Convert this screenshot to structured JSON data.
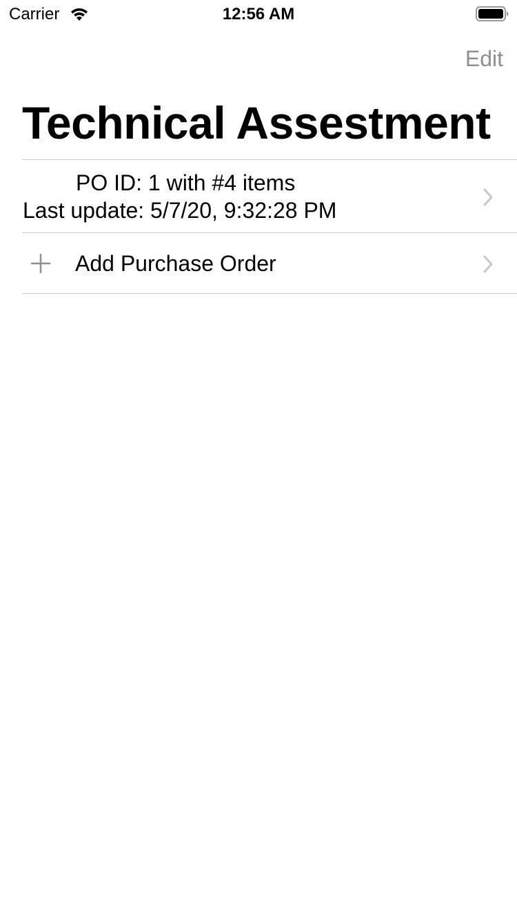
{
  "status_bar": {
    "carrier": "Carrier",
    "time": "12:56 AM",
    "icons": [
      "wifi-icon",
      "battery-icon"
    ]
  },
  "nav": {
    "edit_label": "Edit",
    "title": "Technical Assestment"
  },
  "list": {
    "purchase_orders": [
      {
        "summary": "PO ID: 1 with #4 items",
        "last_update": "Last update: 5/7/20, 9:32:28 PM"
      }
    ],
    "add_row": {
      "label": "Add Purchase Order",
      "icon": "plus-icon"
    }
  },
  "colors": {
    "edit_text": "#8e8e93",
    "separator": "#c8c7cc",
    "chevron": "#c7c7cc",
    "plus": "#8e8e93"
  }
}
